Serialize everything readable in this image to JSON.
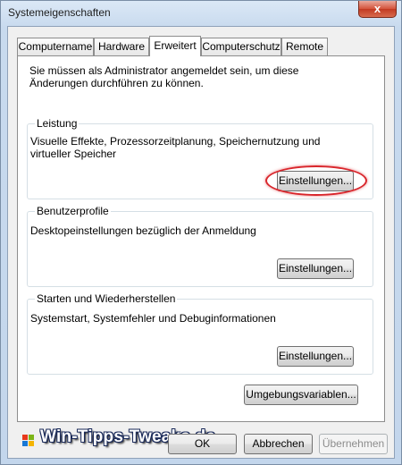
{
  "window": {
    "title": "Systemeigenschaften",
    "close_glyph": "x"
  },
  "tabs": [
    {
      "label": "Computername"
    },
    {
      "label": "Hardware"
    },
    {
      "label": "Erweitert"
    },
    {
      "label": "Computerschutz"
    },
    {
      "label": "Remote"
    }
  ],
  "active_tab": "Erweitert",
  "panel": {
    "admin_note": "Sie müssen als Administrator angemeldet sein, um diese Änderungen durchführen zu können.",
    "groups": {
      "performance": {
        "title": "Leistung",
        "description": "Visuelle Effekte, Prozessorzeitplanung, Speichernutzung und virtueller Speicher",
        "button": "Einstellungen..."
      },
      "profiles": {
        "title": "Benutzerprofile",
        "description": "Desktopeinstellungen bezüglich der Anmeldung",
        "button": "Einstellungen..."
      },
      "startup": {
        "title": "Starten und Wiederherstellen",
        "description": "Systemstart, Systemfehler und Debuginformationen",
        "button": "Einstellungen..."
      }
    },
    "env_button": "Umgebungsvariablen..."
  },
  "watermark": {
    "text": "Win-Tipps-Tweaks.de",
    "icon": "windows-flag-icon"
  },
  "footer": {
    "ok": "OK",
    "cancel": "Abbrechen",
    "apply": "Übernehmen"
  },
  "colors": {
    "highlight": "#d9262c",
    "close_button": "#c23a22"
  }
}
